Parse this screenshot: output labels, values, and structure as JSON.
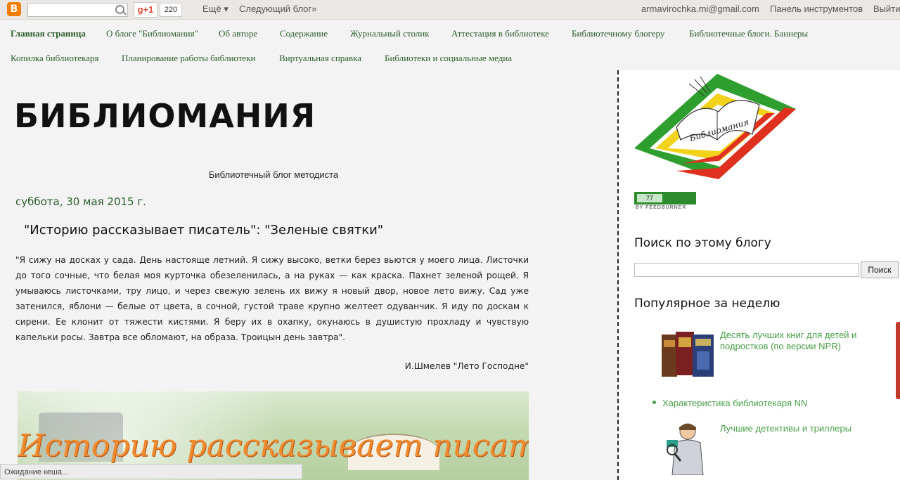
{
  "navbar": {
    "logo_letter": "B",
    "gplus_label": "g+1",
    "gplus_count": "220",
    "more_label": "Ещё ▾",
    "next_blog_label": "Следующий блог»",
    "user_email": "armavirochka.mi@gmail.com",
    "dashboard_label": "Панель инструментов",
    "signout_label": "Выйти"
  },
  "tabs": [
    "Главная страница",
    "О блоге \"Библиомания\"",
    "Об авторе",
    "Содержание",
    "Журнальный столик",
    "Аттестация в библиотеке",
    "Библиотечному блогеру",
    "Библиотечные блоги. Баннеры",
    "Копилка библиотекаря",
    "Планирование работы библиотеки",
    "Виртуальная справка",
    "Библиотеки и социальные медиа"
  ],
  "header": {
    "title": "БИБЛИОМАНИЯ",
    "description": "Библиотечный блог методиста"
  },
  "post": {
    "date": "суббота, 30 мая 2015 г.",
    "title": "\"Историю рассказывает писатель\": \"Зеленые святки\"",
    "body": "\"Я сижу на досках у сада. День настояще летний. Я сижу высоко, ветки берез вьются у моего лица. Листочки до того сочные, что белая моя курточка обезеленилась, а на руках — как краска. Пахнет зеленой рощей. Я умываюсь листочками, тру лицо, и через свежую зелень их вижу я новый двор, новое лето вижу. Сад уже затенился, яблони — белые от цвета, в сочной, густой траве крупно желтеет одуванчик. Я иду по доскам к сирени. Ее клонит от тяжести кистями. Я беру их в охапку, окунаюсь в душистую прохладу и чувствую капельки росы. Завтра все обломают, на образа. Троицын день завтра\".",
    "signature": "И.Шмелев \"Лето Господне\"",
    "image_text": "Историю рассказывает писатель!"
  },
  "sidebar": {
    "logo_text": "Библиомания",
    "feed_count": "77",
    "feed_by": "BY FEEDBURNER",
    "search_title": "Поиск по этому блогу",
    "search_button": "Поиск",
    "popular_title": "Популярное за неделю",
    "popular": [
      "Десять лучших книг для детей и подростков (по версии NPR)",
      "Характеристика библиотекаря NN",
      "Лучшие детективы и триллеры"
    ]
  },
  "status": "Ожидание кеша...",
  "colors": {
    "accent_green": "#2b5d2b",
    "link_green": "#4a9e4a",
    "blogger_orange": "#f57d00"
  }
}
